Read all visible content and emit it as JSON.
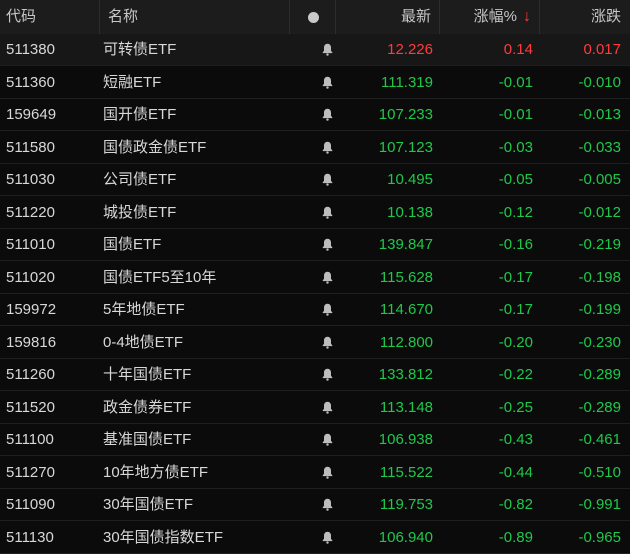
{
  "header": {
    "code": "代码",
    "name": "名称",
    "last": "最新",
    "pct": "涨幅%",
    "sort_arrow": "↓",
    "chg": "涨跌"
  },
  "colors": {
    "up": "#ff3b3b",
    "down": "#20c84a",
    "background": "#0b0b0b"
  },
  "icons": {
    "header_alert": "dot-icon",
    "row_alert": "bell-icon"
  },
  "rows": [
    {
      "code": "511380",
      "name": "可转债ETF",
      "last": "12.226",
      "pct": "0.14",
      "chg": "0.017",
      "dir": "up"
    },
    {
      "code": "511360",
      "name": "短融ETF",
      "last": "111.319",
      "pct": "-0.01",
      "chg": "-0.010",
      "dir": "down"
    },
    {
      "code": "159649",
      "name": "国开债ETF",
      "last": "107.233",
      "pct": "-0.01",
      "chg": "-0.013",
      "dir": "down"
    },
    {
      "code": "511580",
      "name": "国债政金债ETF",
      "last": "107.123",
      "pct": "-0.03",
      "chg": "-0.033",
      "dir": "down"
    },
    {
      "code": "511030",
      "name": "公司债ETF",
      "last": "10.495",
      "pct": "-0.05",
      "chg": "-0.005",
      "dir": "down"
    },
    {
      "code": "511220",
      "name": "城投债ETF",
      "last": "10.138",
      "pct": "-0.12",
      "chg": "-0.012",
      "dir": "down"
    },
    {
      "code": "511010",
      "name": "国债ETF",
      "last": "139.847",
      "pct": "-0.16",
      "chg": "-0.219",
      "dir": "down"
    },
    {
      "code": "511020",
      "name": "国债ETF5至10年",
      "last": "115.628",
      "pct": "-0.17",
      "chg": "-0.198",
      "dir": "down"
    },
    {
      "code": "159972",
      "name": "5年地债ETF",
      "last": "114.670",
      "pct": "-0.17",
      "chg": "-0.199",
      "dir": "down"
    },
    {
      "code": "159816",
      "name": "0-4地债ETF",
      "last": "112.800",
      "pct": "-0.20",
      "chg": "-0.230",
      "dir": "down"
    },
    {
      "code": "511260",
      "name": "十年国债ETF",
      "last": "133.812",
      "pct": "-0.22",
      "chg": "-0.289",
      "dir": "down"
    },
    {
      "code": "511520",
      "name": "政金债券ETF",
      "last": "113.148",
      "pct": "-0.25",
      "chg": "-0.289",
      "dir": "down"
    },
    {
      "code": "511100",
      "name": "基准国债ETF",
      "last": "106.938",
      "pct": "-0.43",
      "chg": "-0.461",
      "dir": "down"
    },
    {
      "code": "511270",
      "name": "10年地方债ETF",
      "last": "115.522",
      "pct": "-0.44",
      "chg": "-0.510",
      "dir": "down"
    },
    {
      "code": "511090",
      "name": "30年国债ETF",
      "last": "119.753",
      "pct": "-0.82",
      "chg": "-0.991",
      "dir": "down"
    },
    {
      "code": "511130",
      "name": "30年国债指数ETF",
      "last": "106.940",
      "pct": "-0.89",
      "chg": "-0.965",
      "dir": "down"
    }
  ]
}
